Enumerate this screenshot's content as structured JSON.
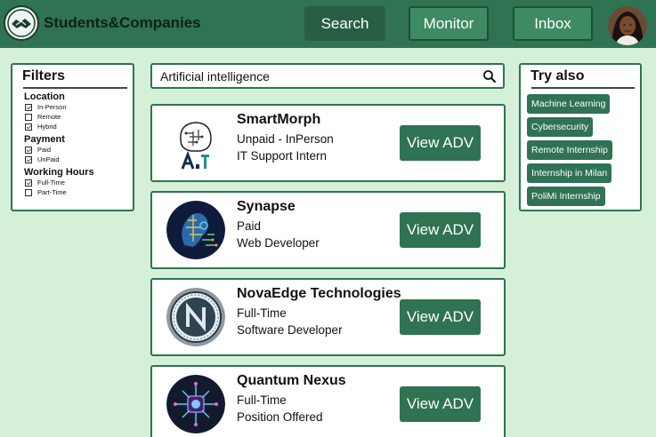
{
  "header": {
    "brand": "Students&Companies",
    "nav": [
      {
        "label": "Search",
        "active": true
      },
      {
        "label": "Monitor",
        "active": false
      },
      {
        "label": "Inbox",
        "active": false
      }
    ]
  },
  "filters": {
    "title": "Filters",
    "groups": [
      {
        "title": "Location",
        "options": [
          {
            "label": "In-Person",
            "checked": true
          },
          {
            "label": "Remote",
            "checked": false
          },
          {
            "label": "Hybrid",
            "checked": true
          }
        ]
      },
      {
        "title": "Payment",
        "options": [
          {
            "label": "Paid",
            "checked": true
          },
          {
            "label": "UnPaid",
            "checked": true
          }
        ]
      },
      {
        "title": "Working Hours",
        "options": [
          {
            "label": "Full-Time",
            "checked": true
          },
          {
            "label": "Part-Time",
            "checked": false
          }
        ]
      }
    ]
  },
  "search": {
    "value": "Artificial intelligence",
    "icon": "search-icon"
  },
  "results": [
    {
      "company": "SmartMorph",
      "line1": "Unpaid - InPerson",
      "line2": "IT Support Intern",
      "button": "View ADV"
    },
    {
      "company": "Synapse",
      "line1": "Paid",
      "line2": "Web Developer",
      "button": "View ADV"
    },
    {
      "company": "NovaEdge Technologies",
      "line1": "Full-Time",
      "line2": "Software Developer",
      "button": "View ADV"
    },
    {
      "company": "Quantum Nexus",
      "line1": "Full-Time",
      "line2": "Position Offered",
      "button": "View ADV"
    }
  ],
  "try_also": {
    "title": "Try also",
    "tags": [
      "Machine Learning",
      "Cybersecurity",
      "Remote Internship",
      "Internship in Milan",
      "PoliMi Internship"
    ]
  },
  "colors": {
    "primary": "#2f7352",
    "background": "#d5f0d9",
    "nav_active": "#2a5e44",
    "nav_inactive": "#3e8a63"
  }
}
